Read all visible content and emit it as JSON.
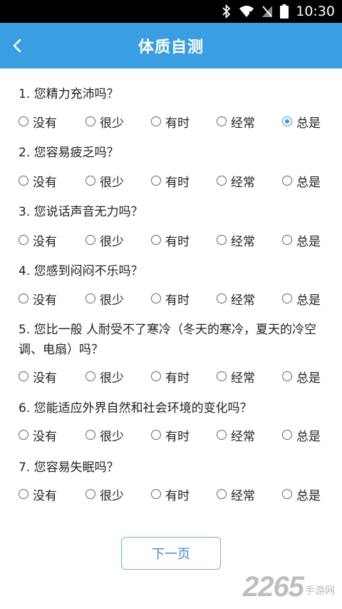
{
  "status_bar": {
    "time": "10:30",
    "icons": [
      "bluetooth-icon",
      "wifi-icon",
      "no-sim-icon",
      "battery-icon"
    ]
  },
  "app_bar": {
    "title": "体质自测",
    "back_icon": "chevron-left-icon"
  },
  "colors": {
    "accent": "#3a9ee2",
    "status_bar": "#000000"
  },
  "options": [
    "没有",
    "很少",
    "有时",
    "经常",
    "总是"
  ],
  "questions": [
    {
      "text": "1. 您精力充沛吗？",
      "selected": 4
    },
    {
      "text": "2. 您容易疲乏吗？",
      "selected": -1
    },
    {
      "text": "3. 您说话声音无力吗？",
      "selected": -1
    },
    {
      "text": "4. 您感到闷闷不乐吗？",
      "selected": -1
    },
    {
      "text": "5. 您比一般 人耐受不了寒冷（冬天的寒冷，夏天的冷空调、电扇）吗？",
      "selected": -1
    },
    {
      "text": "6. 您能适应外界自然和社会环境的变化吗？",
      "selected": -1
    },
    {
      "text": "7. 您容易失眠吗？",
      "selected": -1
    }
  ],
  "next_button": {
    "label": "下一页"
  },
  "watermark": {
    "number": "2265",
    "text": "手游网"
  }
}
